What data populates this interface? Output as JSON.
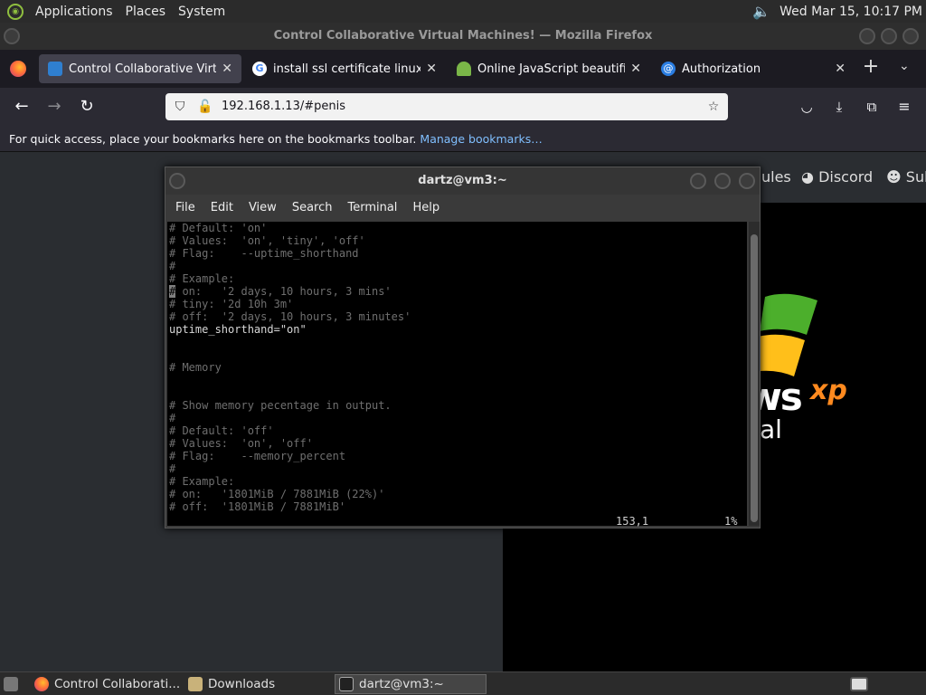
{
  "top_panel": {
    "menus": [
      "Applications",
      "Places",
      "System"
    ],
    "clock": "Wed Mar 15, 10:17 PM"
  },
  "firefox": {
    "window_title": "Control Collaborative Virtual Machines! — Mozilla Firefox",
    "tabs": [
      {
        "label": "Control Collaborative Virtual Machines!",
        "active": true
      },
      {
        "label": "install ssl certificate linux - Google Search",
        "active": false
      },
      {
        "label": "Online JavaScript beautifier",
        "active": false
      },
      {
        "label": "Authorization",
        "active": false
      }
    ],
    "url": "192.168.1.13/#penis",
    "bookmarks_text": "For quick access, place your bookmarks here on the bookmarks toolbar.",
    "bookmarks_link": "Manage bookmarks…"
  },
  "vm_page": {
    "header_items": [
      "ules",
      "Discord",
      "Sub"
    ],
    "xp_text": "ws",
    "xp_sup": "xp",
    "xp_sub": "al"
  },
  "terminal": {
    "title": "dartz@vm3:~",
    "menu": [
      "File",
      "Edit",
      "View",
      "Search",
      "Terminal",
      "Help"
    ],
    "lines": [
      "# Default: 'on'",
      "# Values:  'on', 'tiny', 'off'",
      "# Flag:    --uptime_shorthand",
      "#",
      "# Example:",
      "# on:   '2 days, 10 hours, 3 mins'",
      "# tiny: '2d 10h 3m'",
      "# off:  '2 days, 10 hours, 3 minutes'",
      "uptime_shorthand=\"on\"",
      "",
      "",
      "# Memory",
      "",
      "",
      "# Show memory pecentage in output.",
      "#",
      "# Default: 'off'",
      "# Values:  'on', 'off'",
      "# Flag:    --memory_percent",
      "#",
      "# Example:",
      "# on:   '1801MiB / 7881MiB (22%)'",
      "# off:  '1801MiB / 7881MiB'"
    ],
    "cursor_line": 5,
    "status_position": "153,1",
    "status_percent": "1%"
  },
  "taskbar": {
    "items": [
      "Control Collaborati...",
      "Downloads",
      "dartz@vm3:~"
    ]
  },
  "colors": {
    "firefox_tab_active": "#42414d",
    "terminal_bg": "#000000",
    "link": "#80bfff"
  }
}
